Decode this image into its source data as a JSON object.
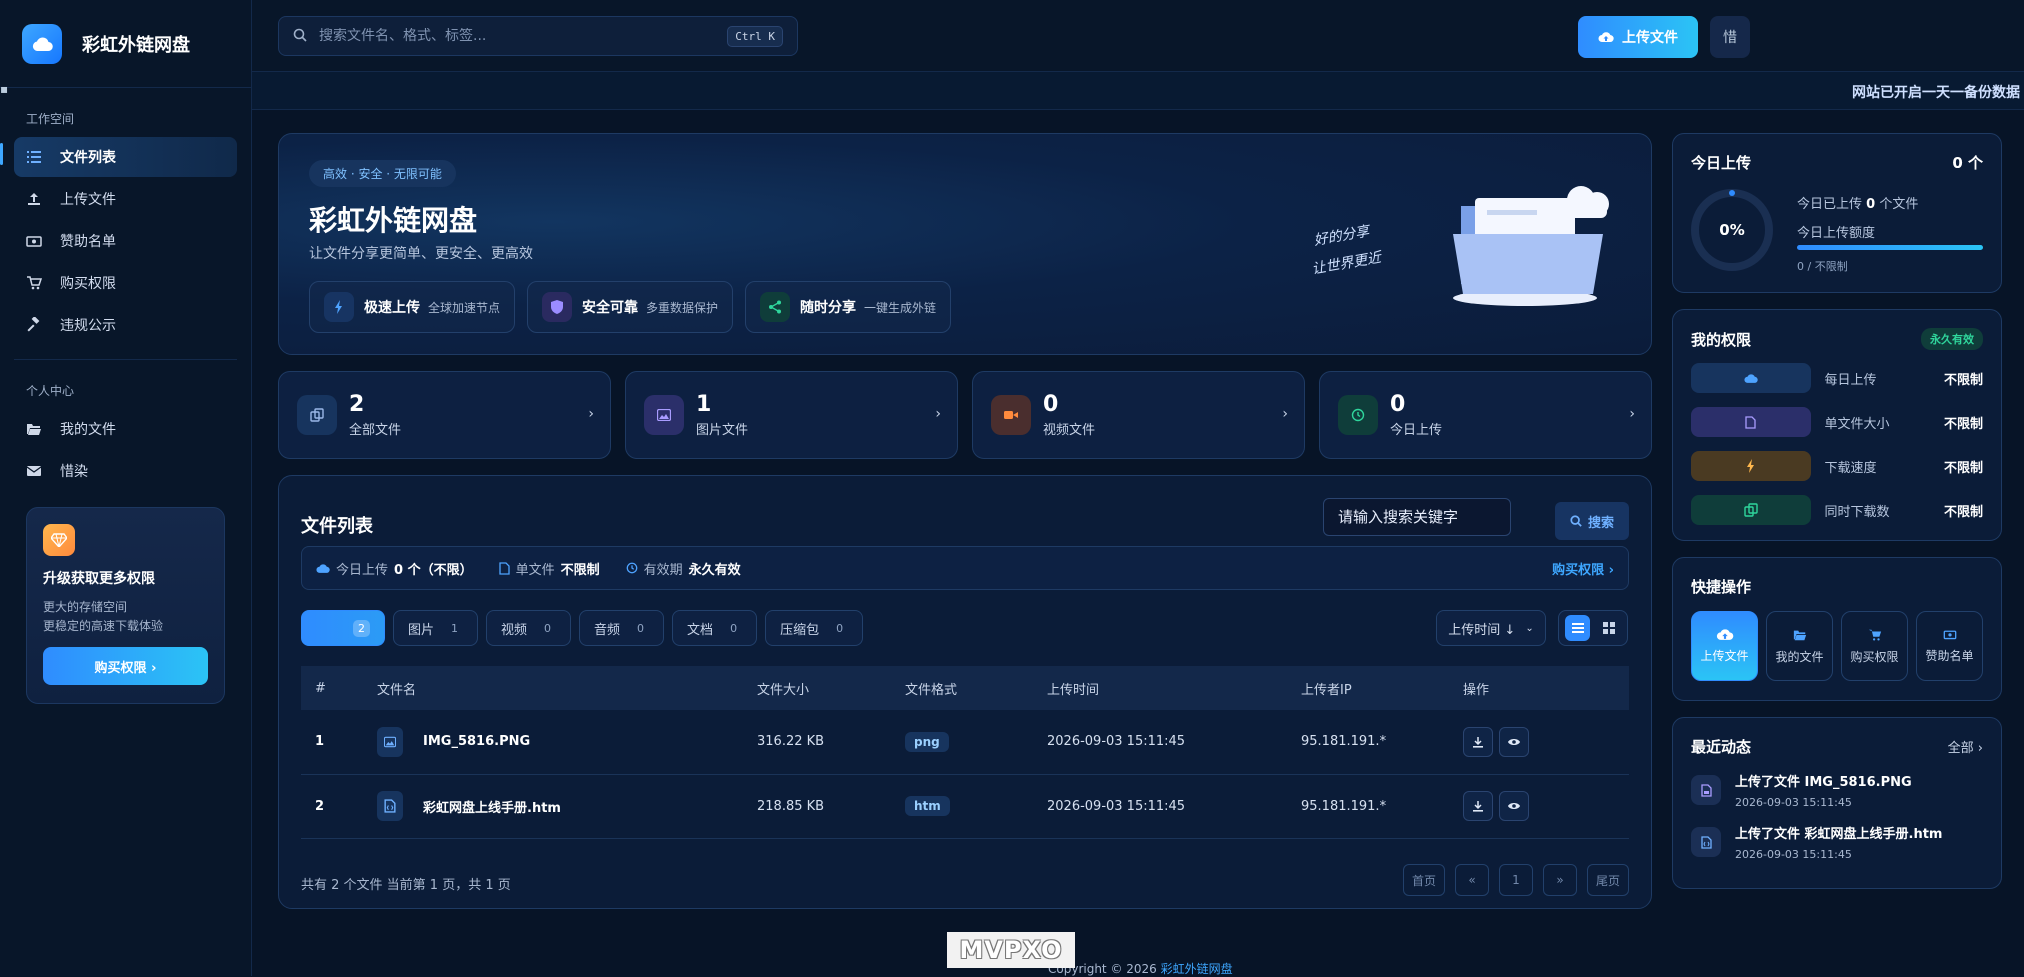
{
  "brand": {
    "name": "彩虹外链网盘"
  },
  "sidebar": {
    "workspace_title": "工作空间",
    "workspace_items": [
      {
        "label": "文件列表",
        "icon": "list-icon"
      },
      {
        "label": "上传文件",
        "icon": "upload-icon"
      },
      {
        "label": "赞助名单",
        "icon": "money-icon"
      },
      {
        "label": "购买权限",
        "icon": "cart-icon"
      },
      {
        "label": "违规公示",
        "icon": "gavel-icon"
      }
    ],
    "personal_title": "个人中心",
    "personal_items": [
      {
        "label": "我的文件",
        "icon": "folder-open-icon"
      },
      {
        "label": "惜染",
        "icon": "mail-icon"
      }
    ],
    "promo": {
      "title": "升级获取更多权限",
      "line1": "更大的存储空间",
      "line2": "更稳定的高速下载体验",
      "button": "购买权限 ›"
    }
  },
  "topbar": {
    "search_placeholder": "搜索文件名、格式、标签...",
    "shortcut": "Ctrl K",
    "upload_button": "上传文件",
    "avatar_text": "惜"
  },
  "marquee": {
    "text": "网站已开启一天一备份数据"
  },
  "hero": {
    "badge": "高效 · 安全 · 无限可能",
    "title": "彩虹外链网盘",
    "subtitle": "让文件分享更简单、更安全、更高效",
    "features": [
      {
        "title": "极速上传",
        "desc": "全球加速节点"
      },
      {
        "title": "安全可靠",
        "desc": "多重数据保护"
      },
      {
        "title": "随时分享",
        "desc": "一键生成外链"
      }
    ],
    "handwriting_line1": "好的分享",
    "handwriting_line2": "让世界更近"
  },
  "stats": [
    {
      "value": "2",
      "label": "全部文件"
    },
    {
      "value": "1",
      "label": "图片文件"
    },
    {
      "value": "0",
      "label": "视频文件"
    },
    {
      "value": "0",
      "label": "今日上传"
    }
  ],
  "files": {
    "title": "文件列表",
    "keyword_placeholder": "请输入搜索关键字",
    "search_button": "搜索",
    "quota": {
      "today_label": "今日上传",
      "today_value": "0 个（不限）",
      "single_label": "单文件",
      "single_value": "不限制",
      "valid_label": "有效期",
      "valid_value": "永久有效",
      "buy_link": "购买权限 ›"
    },
    "tabs": [
      {
        "label": "",
        "count": "2"
      },
      {
        "label": "图片",
        "count": "1"
      },
      {
        "label": "视频",
        "count": "0"
      },
      {
        "label": "音频",
        "count": "0"
      },
      {
        "label": "文档",
        "count": "0"
      },
      {
        "label": "压缩包",
        "count": "0"
      }
    ],
    "sort_label": "上传时间 ↓",
    "columns": [
      "#",
      "文件名",
      "文件大小",
      "文件格式",
      "上传时间",
      "上传者IP",
      "操作"
    ],
    "rows": [
      {
        "idx": "1",
        "name": "IMG_5816.PNG",
        "size": "316.22 KB",
        "format": "png",
        "time": "2026-09-03 15:11:45",
        "ip": "95.181.191.*"
      },
      {
        "idx": "2",
        "name": "彩虹网盘上线手册.htm",
        "size": "218.85 KB",
        "format": "htm",
        "time": "2026-09-03 15:11:45",
        "ip": "95.181.191.*"
      }
    ],
    "pager_info": "共有 2 个文件  当前第 1 页，共 1 页",
    "pager": {
      "first": "首页",
      "prev": "«",
      "page": "1",
      "next": "»",
      "last": "尾页"
    }
  },
  "right": {
    "today": {
      "title": "今日上传",
      "count": "0 个",
      "percent": "0%",
      "line1_pre": "今日已上传",
      "line1_num": "0",
      "line1_post": "个文件",
      "quota_label": "今日上传额度",
      "quota_value": "0 / 不限制"
    },
    "perm": {
      "title": "我的权限",
      "tag": "永久有效",
      "items": [
        {
          "label": "每日上传",
          "value": "不限制"
        },
        {
          "label": "单文件大小",
          "value": "不限制"
        },
        {
          "label": "下载速度",
          "value": "不限制"
        },
        {
          "label": "同时下载数",
          "value": "不限制"
        }
      ]
    },
    "quick": {
      "title": "快捷操作",
      "items": [
        "上传文件",
        "我的文件",
        "购买权限",
        "赞助名单"
      ]
    },
    "activity": {
      "title": "最近动态",
      "more": "全部 ›",
      "items": [
        {
          "text": "上传了文件 IMG_5816.PNG",
          "time": "2026-09-03 15:11:45"
        },
        {
          "text": "上传了文件 彩虹网盘上线手册.htm",
          "time": "2026-09-03 15:11:45"
        }
      ]
    }
  },
  "footer": {
    "text": "Copyright © 2026",
    "link": "彩虹外链网盘"
  },
  "watermark": {
    "text": "MVPXO"
  },
  "colors": {
    "accent": "#2f8cff",
    "accent2": "#2bc4f5",
    "bg": "#071427",
    "card": "#0b1c38"
  }
}
